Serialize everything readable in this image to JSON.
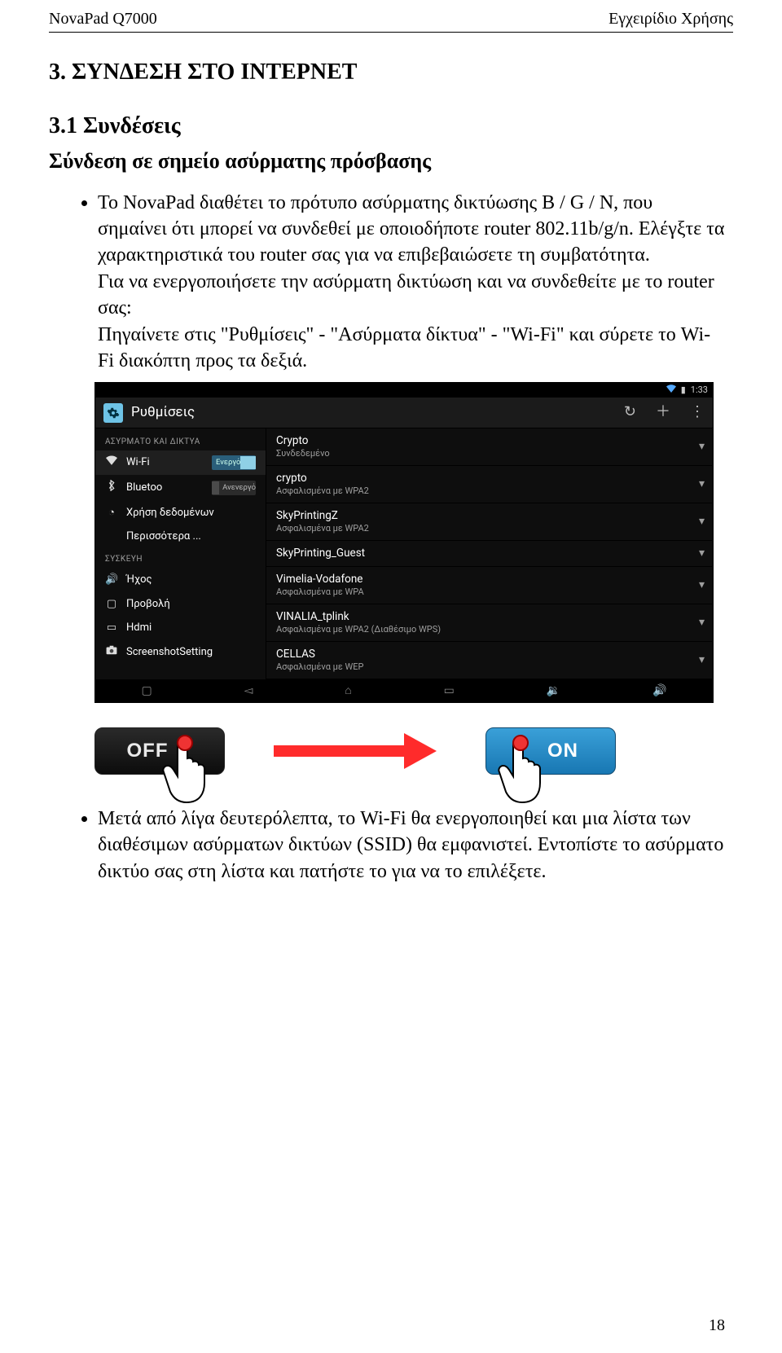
{
  "header": {
    "left": "NovaPad Q7000",
    "right": "Εγχειρίδιο Χρήσης"
  },
  "section_main": "3. ΣΥΝΔΕΣΗ ΣΤΟ ΙΝΤΕΡΝΕΤ",
  "section_sub": "3.1 Συνδέσεις",
  "subtitle": "Σύνδεση σε σημείο ασύρματης πρόσβασης",
  "bullet1": "Το NovaPad διαθέτει το πρότυπο ασύρματης δικτύωσης B / G / N, που σημαίνει ότι μπορεί να συνδεθεί με οποιοδήποτε router 802.11b/g/n. Ελέγξτε τα χαρακτηριστικά του router σας για να επιβεβαιώσετε τη συμβατότητα.",
  "bullet1b": "Για να ενεργοποιήσετε την ασύρματη δικτύωση και να συνδεθείτε με το router σας:",
  "bullet1c": "Πηγαίνετε στις \"Ρυθμίσεις\" - \"Ασύρματα δίκτυα\" - \"Wi-Fi\" και σύρετε το Wi-Fi διακόπτη προς τα δεξιά.",
  "screenshot": {
    "time": "1:33",
    "title": "Ρυθμίσεις",
    "side_head1": "ΑΣΥΡΜΑΤΟ ΚΑΙ ΔΙΚΤΥΑ",
    "wifi": "Wi-Fi",
    "wifi_state": "Ενεργό",
    "bt": "Bluetoo",
    "bt_state": "Ανενεργό",
    "data_usage": "Χρήση δεδομένων",
    "more": "Περισσότερα ...",
    "side_head2": "ΣΥΣΚΕΥΗ",
    "sound": "Ήχος",
    "display": "Προβολή",
    "hdmi": "Hdmi",
    "screenshot_setting": "ScreenshotSetting",
    "networks": [
      {
        "name": "Crypto",
        "sub": "Συνδεδεμένο"
      },
      {
        "name": "crypto",
        "sub": "Ασφαλισμένα με WPA2"
      },
      {
        "name": "SkyPrintingZ",
        "sub": "Ασφαλισμένα με WPA2"
      },
      {
        "name": "SkyPrinting_Guest",
        "sub": ""
      },
      {
        "name": "Vimelia-Vodafone",
        "sub": "Ασφαλισμένα με WPA"
      },
      {
        "name": "VINALIA_tplink",
        "sub": "Ασφαλισμένα με WPA2 (Διαθέσιμο WPS)"
      },
      {
        "name": "CELLAS",
        "sub": "Ασφαλισμένα με WEP"
      }
    ]
  },
  "toggle_fig": {
    "off": "OFF",
    "on": "ON"
  },
  "bullet2": "Μετά από λίγα δευτερόλεπτα, το Wi-Fi θα ενεργοποιηθεί και μια λίστα των διαθέσιμων ασύρματων δικτύων (SSID) θα εμφανιστεί. Εντοπίστε το ασύρματο δικτύο σας στη λίστα και πατήστε το για να το επιλέξετε.",
  "page_number": "18"
}
